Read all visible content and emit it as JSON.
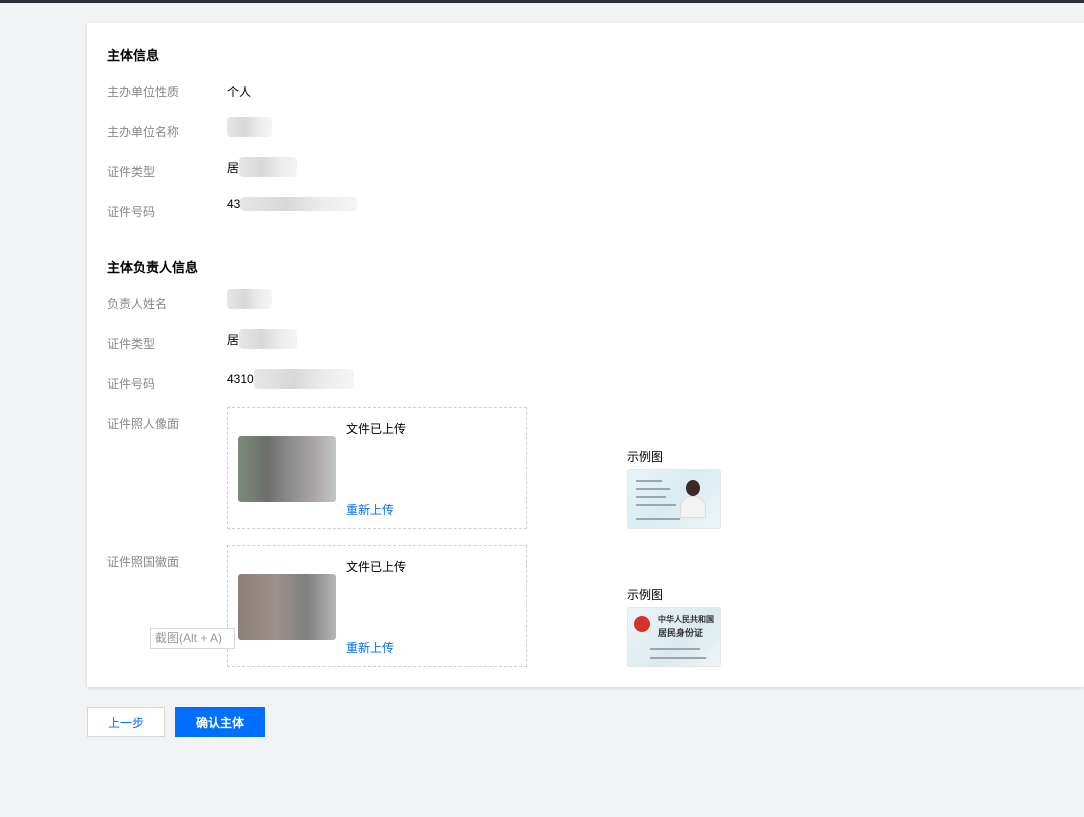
{
  "subject_info": {
    "title": "主体信息",
    "rows": [
      {
        "label": "主办单位性质",
        "value": "个人"
      },
      {
        "label": "主办单位名称",
        "value": ""
      },
      {
        "label": "证件类型",
        "value": "居"
      },
      {
        "label": "证件号码",
        "value": "43"
      }
    ]
  },
  "owner_info": {
    "title": "主体负责人信息",
    "rows": [
      {
        "label": "负责人姓名",
        "value": ""
      },
      {
        "label": "证件类型",
        "value": "居"
      },
      {
        "label": "证件号码",
        "value": "4310"
      }
    ],
    "uploads": [
      {
        "label": "证件照人像面",
        "status": "文件已上传",
        "reupload": "重新上传",
        "sample_label": "示例图"
      },
      {
        "label": "证件照国徽面",
        "status": "文件已上传",
        "reupload": "重新上传",
        "sample_label": "示例图"
      }
    ],
    "id_card_caption_line1": "中华人民共和国",
    "id_card_caption_line2": "居民身份证"
  },
  "tooltip": "截图(Alt + A)",
  "buttons": {
    "prev": "上一步",
    "confirm": "确认主体"
  }
}
